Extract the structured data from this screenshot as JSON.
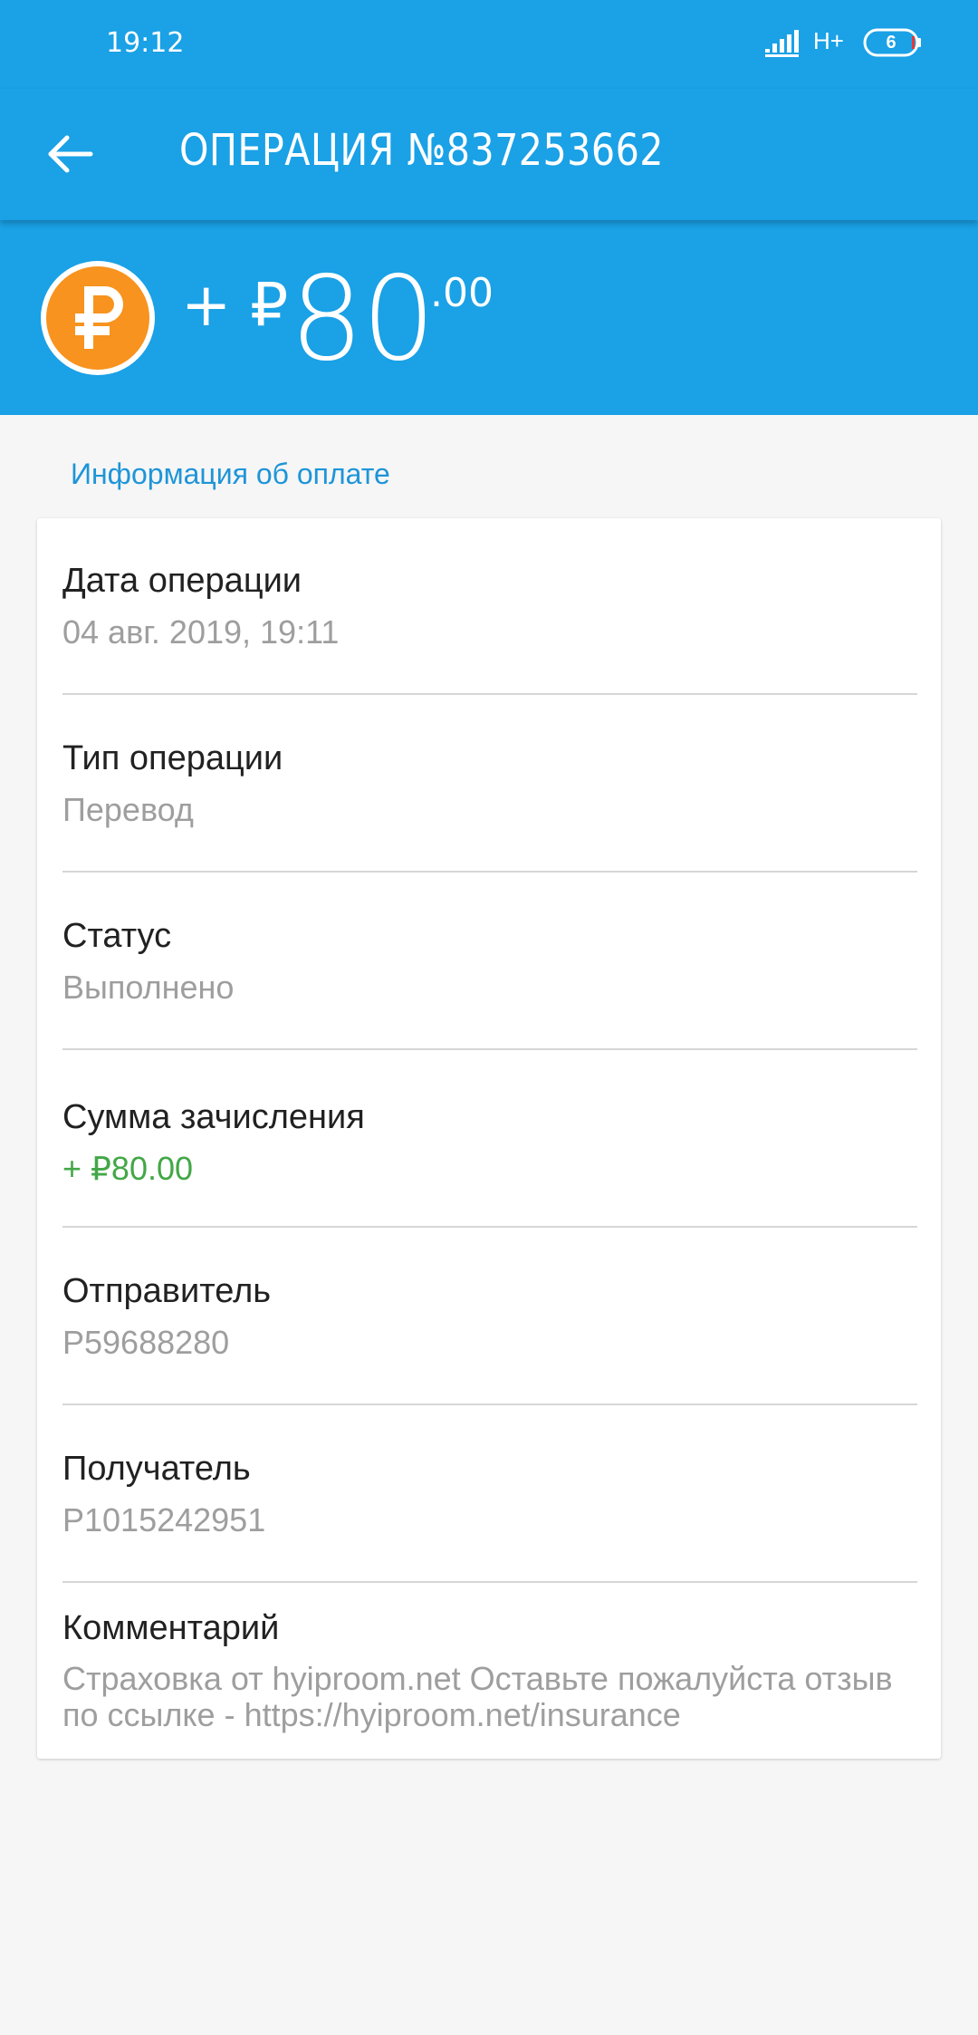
{
  "status_bar": {
    "time": "19:12",
    "network_type": "H+",
    "battery_level": "6",
    "signal_icon": "signal-icon",
    "battery_icon": "battery-icon"
  },
  "toolbar": {
    "back_icon": "arrow-left-icon",
    "title": "ОПЕРАЦИЯ №837253662"
  },
  "summary": {
    "coin_icon": "ruble-coin-icon",
    "prefix": "+ ₽",
    "amount_main": "80",
    "amount_cents": ".00"
  },
  "section": {
    "label": "Информация об оплате"
  },
  "details": {
    "items": [
      {
        "label": "Дата операции",
        "value": "04 авг. 2019, 19:11"
      },
      {
        "label": "Тип операции",
        "value": "Перевод"
      },
      {
        "label": "Статус",
        "value": "Выполнено"
      },
      {
        "label": "Сумма зачисления",
        "value": "+ ₽80.00"
      },
      {
        "label": "Отправитель",
        "value": "P59688280"
      },
      {
        "label": "Получатель",
        "value": "P1015242951"
      },
      {
        "label": "Комментарий",
        "value": "Страховка от hyiproom.net  Оставьте пожалуйста отзыв по ссылке - https://hyiproom.net/insurance"
      }
    ]
  },
  "colors": {
    "header_blue": "#1aa1e6",
    "link_blue": "#1e95d8",
    "credit_green": "#43a747",
    "coin_orange": "#f7931e"
  }
}
